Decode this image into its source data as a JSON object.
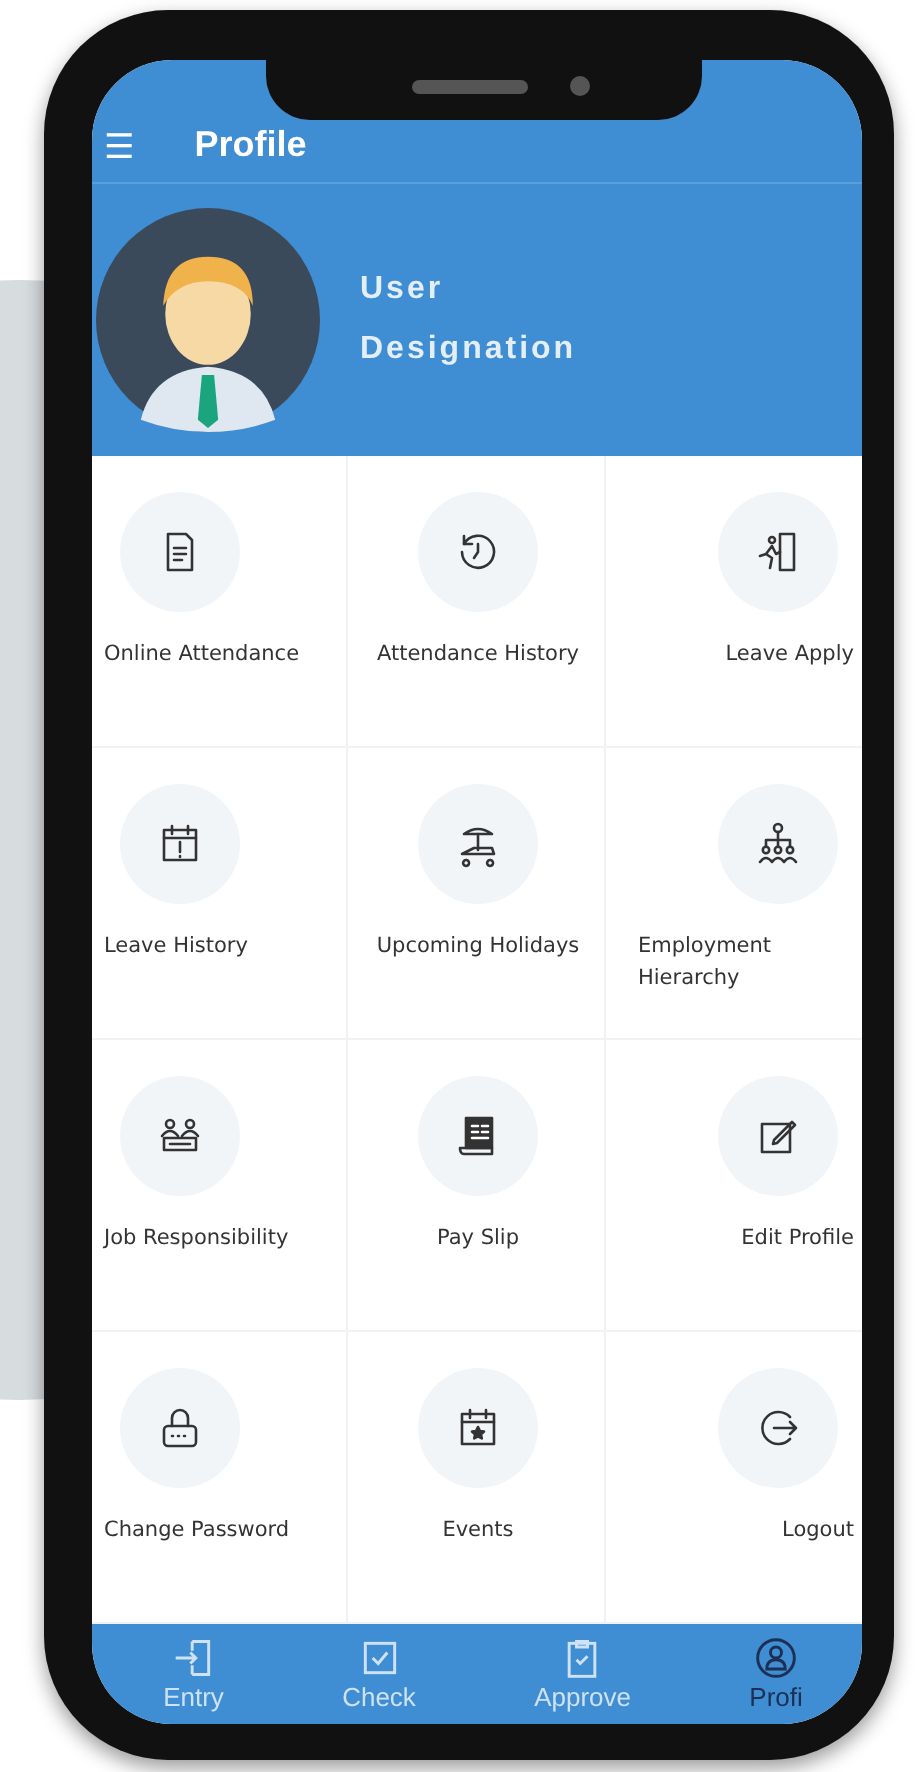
{
  "app_bar": {
    "menu_icon": "☰",
    "title": "Profile"
  },
  "profile": {
    "name": "User",
    "designation": "Designation"
  },
  "tiles": [
    {
      "label": "Online Attendance"
    },
    {
      "label": "Attendance History"
    },
    {
      "label": "Leave Apply"
    },
    {
      "label": "Leave History"
    },
    {
      "label": "Upcoming Holidays"
    },
    {
      "label": "Employment Hierarchy"
    },
    {
      "label": "Job Responsibility"
    },
    {
      "label": "Pay Slip"
    },
    {
      "label": "Edit Profile"
    },
    {
      "label": "Change Password"
    },
    {
      "label": "Events"
    },
    {
      "label": "Logout"
    }
  ],
  "bottom_nav": [
    {
      "label": "Entry",
      "selected": false
    },
    {
      "label": "Check",
      "selected": false
    },
    {
      "label": "Approve",
      "selected": false
    },
    {
      "label": "Profi",
      "selected": true
    }
  ]
}
